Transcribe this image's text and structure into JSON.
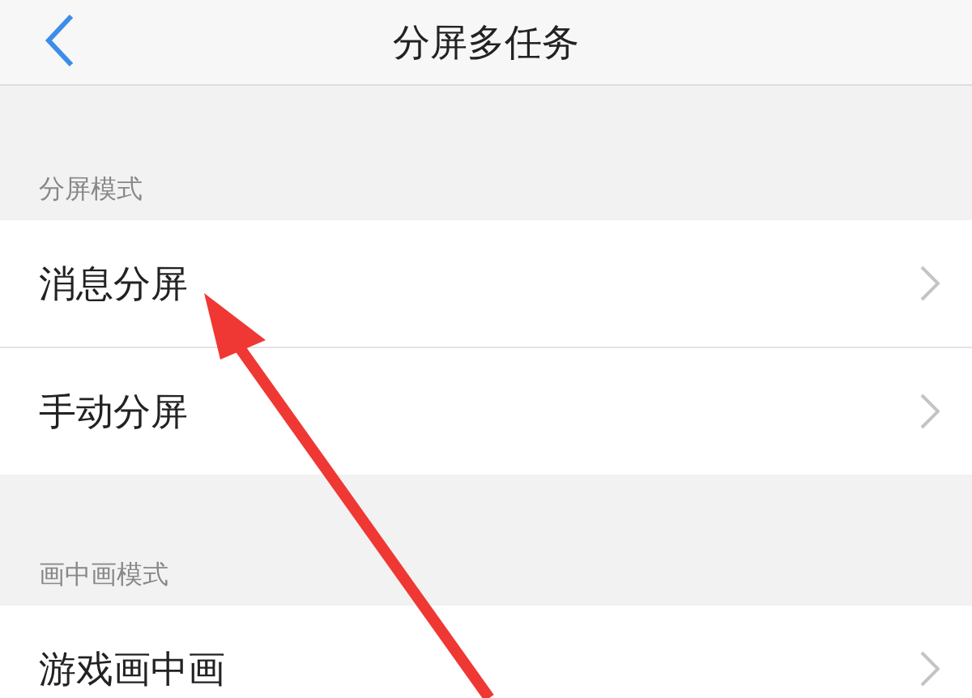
{
  "header": {
    "title": "分屏多任务"
  },
  "sections": [
    {
      "label": "分屏模式",
      "items": [
        {
          "label": "消息分屏"
        },
        {
          "label": "手动分屏"
        }
      ]
    },
    {
      "label": "画中画模式",
      "items": [
        {
          "label": "游戏画中画"
        }
      ]
    }
  ]
}
